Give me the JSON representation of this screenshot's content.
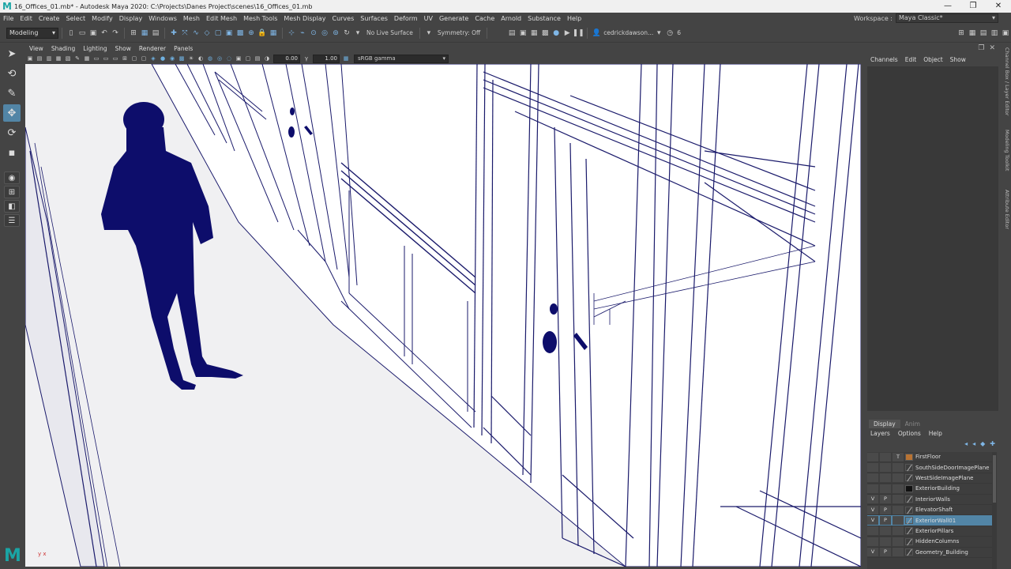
{
  "window": {
    "title": "16_Offices_01.mb* - Autodesk Maya 2020: C:\\Projects\\Danes Project\\scenes\\16_Offices_01.mb",
    "logo": "M",
    "minimize": "—",
    "restore": "❐",
    "close": "✕"
  },
  "menubar": {
    "items": [
      "File",
      "Edit",
      "Create",
      "Select",
      "Modify",
      "Display",
      "Windows",
      "Mesh",
      "Edit Mesh",
      "Mesh Tools",
      "Mesh Display",
      "Curves",
      "Surfaces",
      "Deform",
      "UV",
      "Generate",
      "Cache",
      "Arnold",
      "Substance",
      "Help"
    ],
    "workspace_label": "Workspace :",
    "workspace_value": "Maya Classic*"
  },
  "statusline": {
    "menuset": "Modeling",
    "live_surface": "No Live Surface",
    "symmetry": "Symmetry: Off",
    "user": "cedrickdawson...",
    "notifications": "6"
  },
  "panel": {
    "menu": [
      "View",
      "Shading",
      "Lighting",
      "Show",
      "Renderer",
      "Panels"
    ],
    "exposure": "0.00",
    "gamma": "1.00",
    "colorspace": "sRGB gamma"
  },
  "channelbox": {
    "menu": [
      "Channels",
      "Edit",
      "Object",
      "Show"
    ]
  },
  "sidetabs": [
    "Channel Box / Layer Editor",
    "Modeling Toolkit",
    "Attribute Editor"
  ],
  "layereditor": {
    "tabs": [
      "Display",
      "Anim"
    ],
    "menu": [
      "Layers",
      "Options",
      "Help"
    ],
    "layers": [
      {
        "v": "",
        "p": "",
        "t": "T",
        "name": "FirstFloor",
        "color": "#b87333",
        "selected": false
      },
      {
        "v": "",
        "p": "",
        "t": "",
        "name": "SouthSideDoorImagePlane",
        "color": "",
        "selected": false
      },
      {
        "v": "",
        "p": "",
        "t": "",
        "name": "WestSideImagePlane",
        "color": "",
        "selected": false
      },
      {
        "v": "",
        "p": "",
        "t": "",
        "name": "ExteriorBuilding",
        "color": "#111111",
        "selected": false
      },
      {
        "v": "V",
        "p": "P",
        "t": "",
        "name": "InteriorWalls",
        "color": "",
        "selected": false
      },
      {
        "v": "V",
        "p": "P",
        "t": "",
        "name": "ElevatorShaft",
        "color": "",
        "selected": false
      },
      {
        "v": "V",
        "p": "P",
        "t": "",
        "name": "ExteriorWall01",
        "color": "",
        "selected": true
      },
      {
        "v": "",
        "p": "",
        "t": "",
        "name": "ExteriorPillars",
        "color": "",
        "selected": false
      },
      {
        "v": "",
        "p": "",
        "t": "",
        "name": "HiddenColumns",
        "color": "",
        "selected": false
      },
      {
        "v": "V",
        "p": "P",
        "t": "",
        "name": "Geometry_Building",
        "color": "",
        "selected": false
      }
    ]
  },
  "viewport": {
    "accent": "#0d0d6b",
    "axis_label": "y x"
  }
}
